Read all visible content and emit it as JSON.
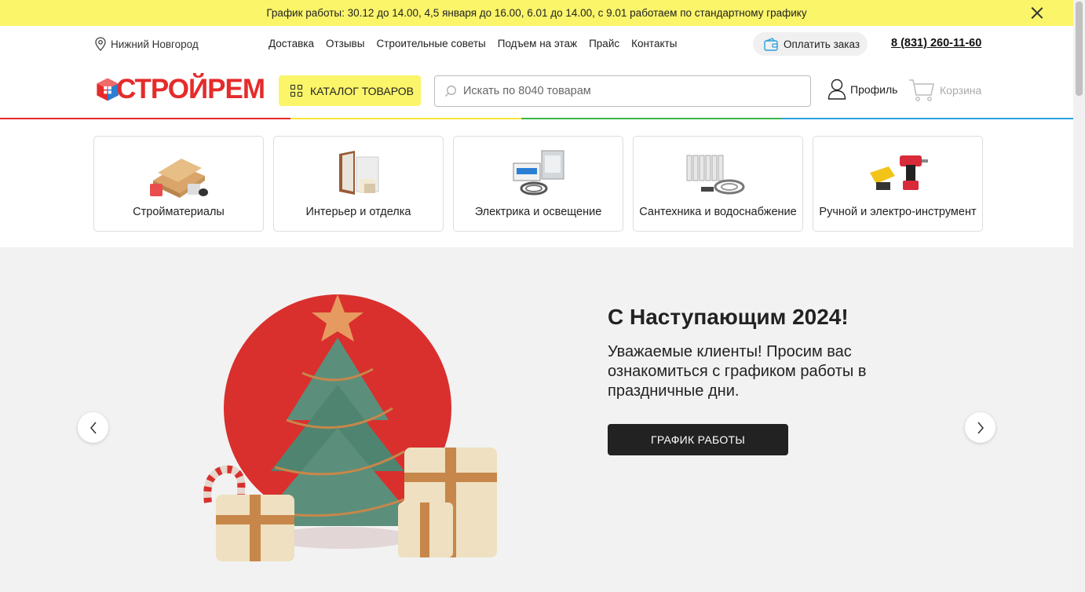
{
  "notice": {
    "text": "График работы: 30.12 до 14.00, 4,5 января до 16.00, 6.01 до 14.00, с 9.01 работаем по стандартному графику"
  },
  "topbar": {
    "city": "Нижний Новгород",
    "nav": [
      "Доставка",
      "Отзывы",
      "Строительные советы",
      "Подъем на этаж",
      "Прайс",
      "Контакты"
    ],
    "pay_label": "Оплатить заказ",
    "phone": "8 (831) 260-11-60"
  },
  "header": {
    "logo_text": "СТРОЙРЕМ",
    "catalog_label": "КАТАЛОГ ТОВАРОВ",
    "search_placeholder": "Искать по 8040 товарам",
    "profile_label": "Профиль",
    "cart_label": "Корзина"
  },
  "colors": {
    "accent_yellow": "#fbf56a",
    "brand_red": "#e52b2b",
    "brand_blue": "#2a7fd4",
    "rainbow": [
      "#e52b2b",
      "#f7e53b",
      "#38b54a",
      "#2a9fe0"
    ]
  },
  "categories": [
    {
      "label": "Стройматериалы",
      "icon": "building-materials-image"
    },
    {
      "label": "Интерьер и отделка",
      "icon": "interior-door-image"
    },
    {
      "label": "Электрика и освещение",
      "icon": "electrical-panel-image"
    },
    {
      "label": "Сантехника и водоснабжение",
      "icon": "radiator-pipes-image"
    },
    {
      "label": "Ручной и электро-инструмент",
      "icon": "power-tools-image"
    }
  ],
  "banner": {
    "title": "С Наступающим 2024!",
    "text": "Уважаемые клиенты! Просим вас ознакомиться с графиком работы в праздничные дни.",
    "button_label": "ГРАФИК РАБОТЫ"
  }
}
